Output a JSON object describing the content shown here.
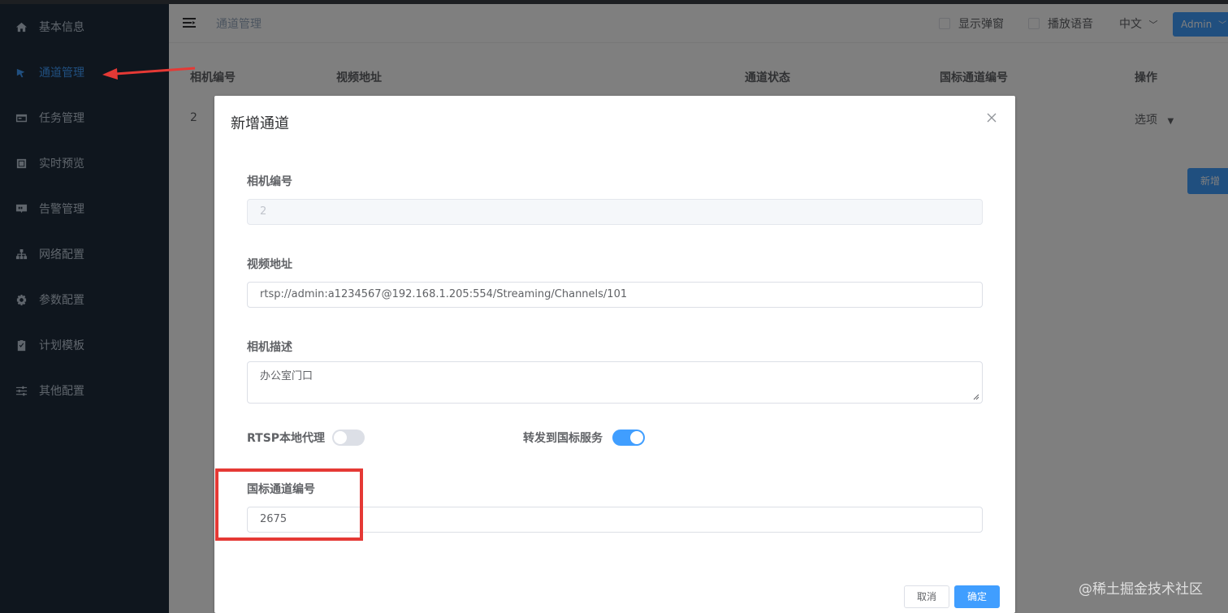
{
  "sidebar": {
    "items": [
      {
        "label": "基本信息",
        "icon": "home-icon"
      },
      {
        "label": "通道管理",
        "icon": "channel-icon",
        "active": true
      },
      {
        "label": "任务管理",
        "icon": "task-icon"
      },
      {
        "label": "实时预览",
        "icon": "preview-icon"
      },
      {
        "label": "告警管理",
        "icon": "alarm-icon"
      },
      {
        "label": "网络配置",
        "icon": "network-icon"
      },
      {
        "label": "参数配置",
        "icon": "gear-icon"
      },
      {
        "label": "计划模板",
        "icon": "clipboard-icon"
      },
      {
        "label": "其他配置",
        "icon": "sliders-icon"
      }
    ]
  },
  "header": {
    "breadcrumb": "通道管理",
    "show_popup_label": "显示弹窗",
    "play_voice_label": "播放语音",
    "language": "中文",
    "user": "Admin"
  },
  "table": {
    "columns": [
      "相机编号",
      "视频地址",
      "通道状态",
      "国标通道编号",
      "操作"
    ],
    "rows": [
      {
        "camera_id": "2",
        "action": "选项"
      }
    ],
    "add_button": "新增"
  },
  "dialog": {
    "title": "新增通道",
    "camera_id_label": "相机编号",
    "camera_id_value": "2",
    "video_url_label": "视频地址",
    "video_url_value": "rtsp://admin:a1234567@192.168.1.205:554/Streaming/Channels/101",
    "camera_desc_label": "相机描述",
    "camera_desc_value": "办公室门口",
    "rtsp_proxy_label": "RTSP本地代理",
    "rtsp_proxy_on": false,
    "forward_gb_label": "转发到国标服务",
    "forward_gb_on": true,
    "gb_channel_label": "国标通道编号",
    "gb_channel_value": "2675",
    "cancel_label": "取消",
    "confirm_label": "确定"
  },
  "watermark": "@稀土掘金技术社区",
  "colors": {
    "sidebar_bg": "#1f2d3d",
    "primary": "#409eff",
    "annotation_red": "#e53935"
  }
}
